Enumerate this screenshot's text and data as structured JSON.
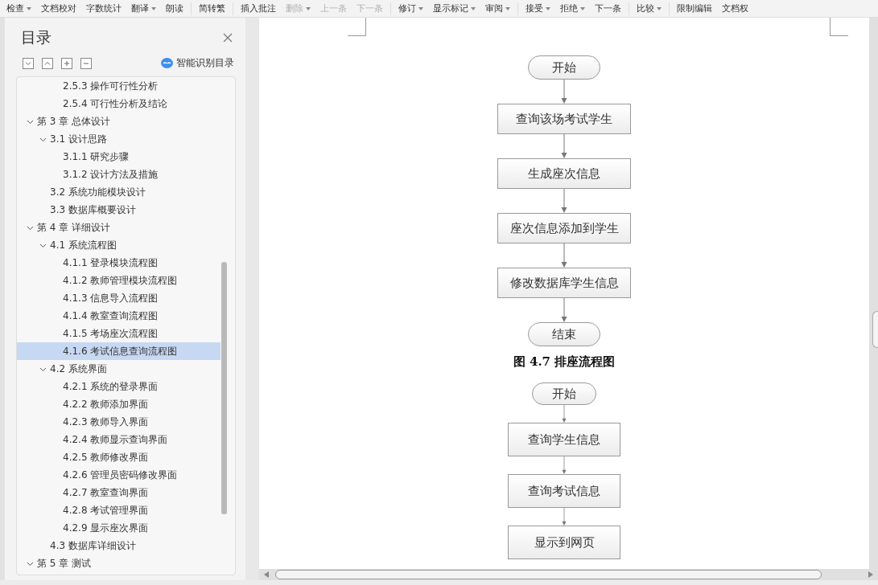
{
  "toolbar": {
    "groups": [
      [
        {
          "label": "检查",
          "dropdown": true,
          "disabled": false
        },
        {
          "label": "文档校对",
          "dropdown": false,
          "disabled": false
        },
        {
          "label": "字数统计",
          "dropdown": false,
          "disabled": false
        },
        {
          "label": "翻译",
          "dropdown": true,
          "disabled": false
        },
        {
          "label": "朗读",
          "dropdown": false,
          "disabled": false
        }
      ],
      [
        {
          "label": "简转繁",
          "dropdown": false,
          "disabled": false
        }
      ],
      [
        {
          "label": "插入批注",
          "dropdown": false,
          "disabled": false
        },
        {
          "label": "删除",
          "dropdown": true,
          "disabled": true
        },
        {
          "label": "上一条",
          "dropdown": false,
          "disabled": true
        },
        {
          "label": "下一条",
          "dropdown": false,
          "disabled": true
        }
      ],
      [
        {
          "label": "修订",
          "dropdown": true,
          "disabled": false
        },
        {
          "label": "显示标记",
          "dropdown": true,
          "disabled": false
        },
        {
          "label": "审阅",
          "dropdown": true,
          "disabled": false
        }
      ],
      [
        {
          "label": "接受",
          "dropdown": true,
          "disabled": false
        },
        {
          "label": "拒绝",
          "dropdown": true,
          "disabled": false
        },
        {
          "label": "下一条",
          "dropdown": false,
          "disabled": false
        }
      ],
      [
        {
          "label": "比较",
          "dropdown": true,
          "disabled": false
        }
      ],
      [
        {
          "label": "限制编辑",
          "dropdown": false,
          "disabled": false
        },
        {
          "label": "文档权",
          "dropdown": false,
          "disabled": false
        }
      ]
    ]
  },
  "toc": {
    "title": "目录",
    "smart_label": "智能识别目录",
    "items": [
      {
        "children": [
          {
            "children": [
              {
                "label": "2.5.3 操作可行性分析",
                "selected": false
              },
              {
                "label": "2.5.4 可行性分析及结论",
                "selected": false
              }
            ]
          }
        ]
      },
      {
        "label": "第 3 章  总体设计",
        "expanded": true,
        "selected": false,
        "children": [
          {
            "label": "3.1 设计思路",
            "expanded": true,
            "selected": false,
            "children": [
              {
                "label": "3.1.1 研究步骤",
                "selected": false
              },
              {
                "label": "3.1.2 设计方法及措施",
                "selected": false
              }
            ]
          },
          {
            "label": "3.2 系统功能模块设计",
            "selected": false
          },
          {
            "label": "3.3 数据库概要设计",
            "selected": false
          }
        ]
      },
      {
        "label": "第 4 章  详细设计",
        "expanded": true,
        "selected": false,
        "children": [
          {
            "label": "4.1 系统流程图",
            "expanded": true,
            "selected": false,
            "children": [
              {
                "label": "4.1.1 登录模块流程图",
                "selected": false
              },
              {
                "label": "4.1.2 教师管理模块流程图",
                "selected": false
              },
              {
                "label": "4.1.3 信息导入流程图",
                "selected": false
              },
              {
                "label": "4.1.4 教室查询流程图",
                "selected": false
              },
              {
                "label": "4.1.5 考场座次流程图",
                "selected": false
              },
              {
                "label": "4.1.6 考试信息查询流程图",
                "selected": true
              }
            ]
          },
          {
            "label": "4.2 系统界面",
            "expanded": true,
            "selected": false,
            "children": [
              {
                "label": "4.2.1 系统的登录界面",
                "selected": false
              },
              {
                "label": "4.2.2 教师添加界面",
                "selected": false
              },
              {
                "label": "4.2.3 教师导入界面",
                "selected": false
              },
              {
                "label": "4.2.4 教师显示查询界面",
                "selected": false
              },
              {
                "label": "4.2.5 教师修改界面",
                "selected": false
              },
              {
                "label": "4.2.6 管理员密码修改界面",
                "selected": false
              },
              {
                "label": "4.2.7 教室查询界面",
                "selected": false
              },
              {
                "label": "4.2.8 考试管理界面",
                "selected": false
              },
              {
                "label": "4.2.9 显示座次界面",
                "selected": false
              }
            ]
          },
          {
            "label": "4.3 数据库详细设计",
            "selected": false
          }
        ]
      },
      {
        "label": "第 5 章  测试",
        "expanded": true,
        "selected": false
      }
    ]
  },
  "document": {
    "flowcharts": [
      {
        "nodes": [
          {
            "kind": "terminal",
            "text": "开始"
          },
          {
            "kind": "process",
            "text": "查询该场考试学生"
          },
          {
            "kind": "process",
            "text": "生成座次信息"
          },
          {
            "kind": "process",
            "text": "座次信息添加到学生"
          },
          {
            "kind": "process",
            "text": "修改数据库学生信息"
          },
          {
            "kind": "terminal",
            "text": "结束"
          }
        ],
        "caption": "图 4.7  排座流程图"
      },
      {
        "nodes": [
          {
            "kind": "terminal",
            "text": "开始"
          },
          {
            "kind": "process",
            "text": "查询学生信息"
          },
          {
            "kind": "process",
            "text": "查询考试信息"
          },
          {
            "kind": "process",
            "text": "显示到网页"
          }
        ]
      }
    ]
  }
}
